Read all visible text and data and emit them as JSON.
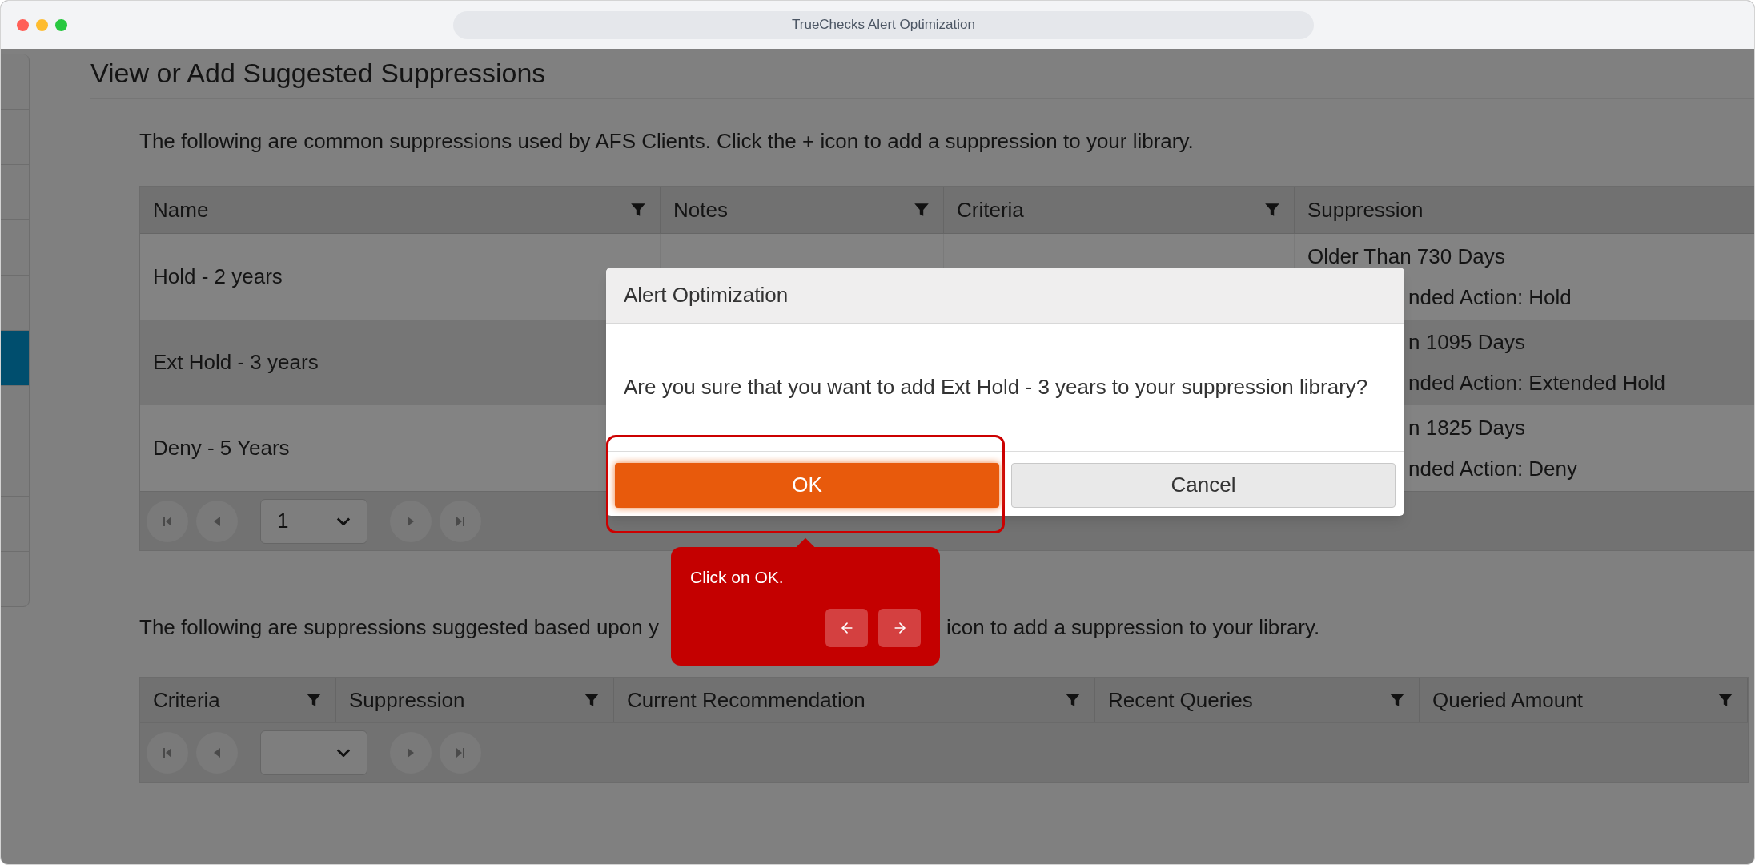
{
  "window": {
    "title": "TrueChecks Alert Optimization"
  },
  "sidebar": {
    "items": [
      {
        "selected": false
      },
      {
        "selected": false
      },
      {
        "selected": false
      },
      {
        "selected": false
      },
      {
        "selected": false
      },
      {
        "selected": true
      },
      {
        "selected": false
      },
      {
        "selected": false
      },
      {
        "selected": false
      },
      {
        "selected": false
      }
    ]
  },
  "heading": "View or Add Suggested Suppressions",
  "intro": "The following are common suppressions used by AFS Clients. Click the + icon to add a suppression to your library.",
  "common_table": {
    "columns": [
      {
        "label": "Name",
        "filter": true
      },
      {
        "label": "Notes",
        "filter": true
      },
      {
        "label": "Criteria",
        "filter": true
      },
      {
        "label": "Suppression"
      }
    ],
    "rows": [
      {
        "name": "Hold - 2 years",
        "selected": false,
        "suppression": [
          {
            "text": "Older Than 730 Days",
            "clipped": false
          },
          {
            "text": "nded Action: Hold",
            "clipped": true
          }
        ]
      },
      {
        "name": "Ext Hold - 3 years",
        "selected": true,
        "suppression": [
          {
            "text": "n 1095 Days",
            "clipped": true
          },
          {
            "text": "nded Action: Extended Hold",
            "clipped": true
          }
        ]
      },
      {
        "name": "Deny - 5 Years",
        "selected": false,
        "suppression": [
          {
            "text": "n 1825 Days",
            "clipped": true
          },
          {
            "text": "nded Action: Deny",
            "clipped": true
          }
        ]
      }
    ],
    "pager": {
      "page": "1"
    }
  },
  "suggested_intro": [
    "The following are suppressions suggested based upon y",
    "icon to add a suppression to your library."
  ],
  "suggested_table": {
    "columns": [
      {
        "label": "Criteria",
        "filter": true
      },
      {
        "label": "Suppression",
        "filter": true
      },
      {
        "label": "Current Recommendation",
        "filter": true
      },
      {
        "label": "Recent Queries",
        "filter": true
      },
      {
        "label": "Queried Amount",
        "filter": true
      }
    ]
  },
  "dialog": {
    "title": "Alert Optimization",
    "message": "Are you sure that you want to add Ext Hold - 3 years to your suppression library?",
    "buttons": [
      {
        "label": "OK",
        "kind": "primary",
        "highlighted": true
      },
      {
        "label": "Cancel",
        "kind": "secondary",
        "highlighted": false
      }
    ]
  },
  "tooltip": {
    "text": "Click on OK."
  }
}
